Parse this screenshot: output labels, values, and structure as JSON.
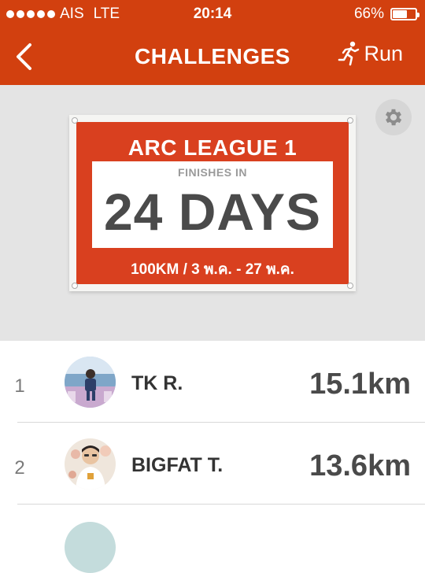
{
  "status_bar": {
    "carrier": "AIS",
    "network": "LTE",
    "time": "20:14",
    "battery": "66%",
    "battery_level": 0.66
  },
  "nav": {
    "title": "CHALLENGES",
    "run_label": "Run"
  },
  "challenge": {
    "name": "ARC LEAGUE 1",
    "finishes_label": "FINISHES IN",
    "days": "24 DAYS",
    "details": "100KM / 3 พ.ค. - 27 พ.ค."
  },
  "leaderboard": [
    {
      "rank": "1",
      "name": "TK R.",
      "distance": "15.1km"
    },
    {
      "rank": "2",
      "name": "BIGFAT T.",
      "distance": "13.6km"
    }
  ],
  "colors": {
    "brand": "#d2400f",
    "bib_red": "#d9401f",
    "banner_bg": "#e4e4e4"
  }
}
